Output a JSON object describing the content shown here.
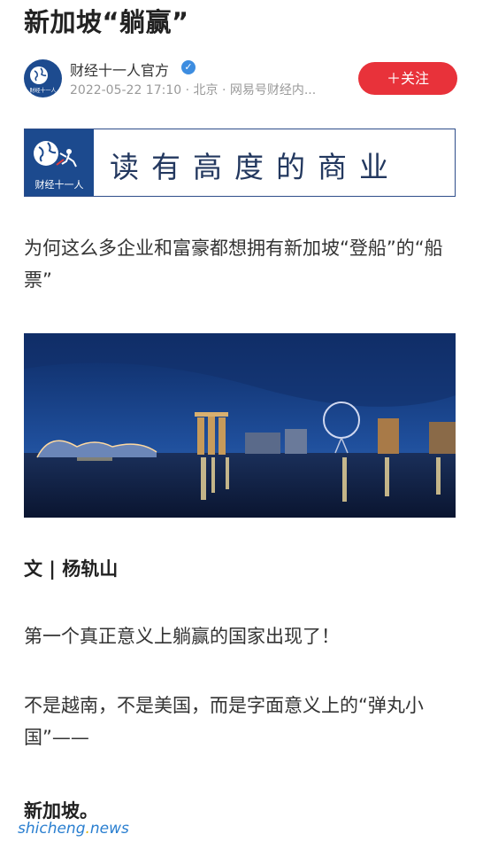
{
  "article": {
    "title": "新加坡“躺赢”"
  },
  "author": {
    "name": "财经十一人官方",
    "meta": "2022-05-22 17:10 · 北京 · 网易号财经内...",
    "follow_label": "＋关注",
    "avatar_text": "财经十一人"
  },
  "banner": {
    "logo_text": "财经十一人",
    "slogan": "读有高度的商业"
  },
  "body": {
    "p1": "为何这么多企业和富豪都想拥有新加坡“登船”的“船票”",
    "byline": "文 | 杨轨山",
    "p3": "第一个真正意义上躺赢的国家出现了！",
    "p4": "不是越南，不是美国，而是字面意义上的“弹丸小国”——",
    "p5": "新加坡。"
  },
  "watermark": {
    "prefix": "shicheng",
    "dot": ".",
    "suffix": "news"
  },
  "colors": {
    "follow_button": "#e8323a",
    "verified": "#3d8de0",
    "brand_blue": "#1c4a8e"
  }
}
